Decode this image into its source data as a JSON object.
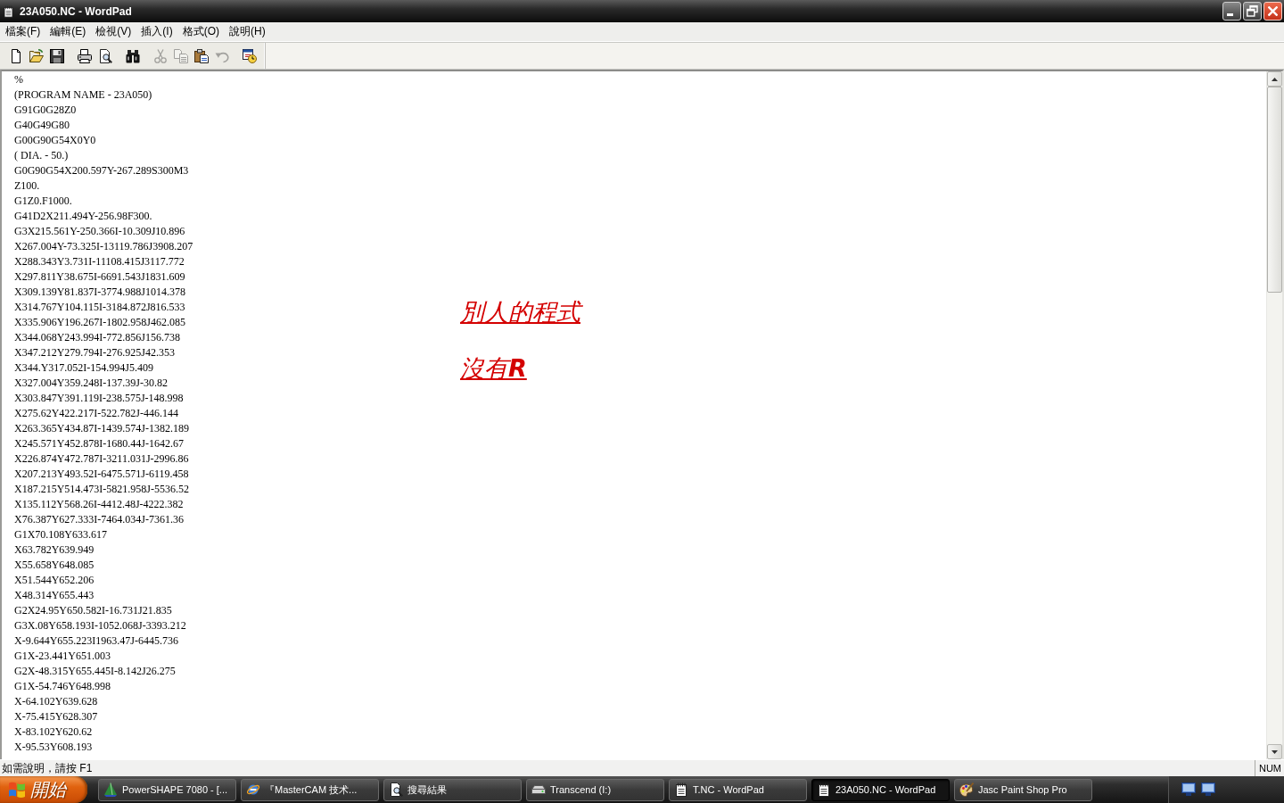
{
  "window": {
    "title": "23A050.NC - WordPad"
  },
  "menu": [
    "檔案(F)",
    "編輯(E)",
    "檢視(V)",
    "插入(I)",
    "格式(O)",
    "說明(H)"
  ],
  "toolbar": [
    {
      "buttons": [
        {
          "kind": "new",
          "disabled": false
        },
        {
          "kind": "open",
          "disabled": false
        },
        {
          "kind": "save",
          "disabled": false
        }
      ]
    },
    {
      "buttons": [
        {
          "kind": "print",
          "disabled": false
        },
        {
          "kind": "preview",
          "disabled": false
        }
      ]
    },
    {
      "buttons": [
        {
          "kind": "find",
          "disabled": false
        }
      ]
    },
    {
      "buttons": [
        {
          "kind": "cut",
          "disabled": true
        },
        {
          "kind": "copy",
          "disabled": true
        },
        {
          "kind": "paste",
          "disabled": false
        },
        {
          "kind": "undo",
          "disabled": true
        }
      ]
    },
    {
      "buttons": [
        {
          "kind": "datetime",
          "disabled": false
        }
      ]
    }
  ],
  "document": {
    "lines": [
      "%",
      "(PROGRAM NAME - 23A050)",
      "G91G0G28Z0",
      "G40G49G80",
      "G00G90G54X0Y0",
      "( DIA. - 50.)",
      "G0G90G54X200.597Y-267.289S300M3",
      "Z100.",
      "G1Z0.F1000.",
      "G41D2X211.494Y-256.98F300.",
      "G3X215.561Y-250.366I-10.309J10.896",
      "X267.004Y-73.325I-13119.786J3908.207",
      "X288.343Y3.731I-11108.415J3117.772",
      "X297.811Y38.675I-6691.543J1831.609",
      "X309.139Y81.837I-3774.988J1014.378",
      "X314.767Y104.115I-3184.872J816.533",
      "X335.906Y196.267I-1802.958J462.085",
      "X344.068Y243.994I-772.856J156.738",
      "X347.212Y279.794I-276.925J42.353",
      "X344.Y317.052I-154.994J5.409",
      "X327.004Y359.248I-137.39J-30.82",
      "X303.847Y391.119I-238.575J-148.998",
      "X275.62Y422.217I-522.782J-446.144",
      "X263.365Y434.87I-1439.574J-1382.189",
      "X245.571Y452.878I-1680.44J-1642.67",
      "X226.874Y472.787I-3211.031J-2996.86",
      "X207.213Y493.52I-6475.571J-6119.458",
      "X187.215Y514.473I-5821.958J-5536.52",
      "X135.112Y568.26I-4412.48J-4222.382",
      "X76.387Y627.333I-7464.034J-7361.36",
      "G1X70.108Y633.617",
      "X63.782Y639.949",
      "X55.658Y648.085",
      "X51.544Y652.206",
      "X48.314Y655.443",
      "G2X24.95Y650.582I-16.731J21.835",
      "G3X.08Y658.193I-1052.068J-3393.212",
      "X-9.644Y655.223I1963.47J-6445.736",
      "G1X-23.441Y651.003",
      "G2X-48.315Y655.445I-8.142J26.275",
      "G1X-54.746Y648.998",
      "X-64.102Y639.628",
      "X-75.415Y628.307",
      "X-83.102Y620.62",
      "X-95.53Y608.193"
    ]
  },
  "annotation": {
    "lines": [
      "別人的程式",
      "沒有**R**"
    ]
  },
  "status_bar": {
    "hint": "如需說明，請按 F1",
    "indicator": "NUM"
  },
  "taskbar": {
    "start": "開始",
    "tasks": [
      {
        "kind": "powershape",
        "label": "PowerSHAPE 7080 - [...",
        "selected": false
      },
      {
        "kind": "browser",
        "label": "『MasterCAM 技术...",
        "selected": false
      },
      {
        "kind": "search",
        "label": "搜尋結果",
        "selected": false
      },
      {
        "kind": "drive",
        "label": "Transcend (I:)",
        "selected": false
      },
      {
        "kind": "wordpad",
        "label": "T.NC - WordPad",
        "selected": false
      },
      {
        "kind": "wordpad",
        "label": "23A050.NC - WordPad",
        "selected": true
      },
      {
        "kind": "paint",
        "label": "Jasc Paint Shop Pro",
        "selected": false
      }
    ]
  }
}
